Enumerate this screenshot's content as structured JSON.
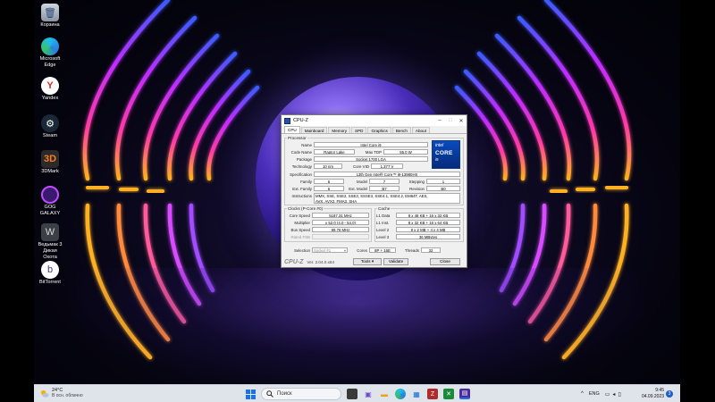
{
  "desktop": {
    "icons": [
      {
        "label": "Корзина",
        "icon": "recycle-bin-icon"
      },
      {
        "label": "Microsoft Edge",
        "icon": "edge-icon"
      },
      {
        "label": "Yandex",
        "icon": "yandex-icon"
      },
      {
        "label": "Steam",
        "icon": "steam-icon"
      },
      {
        "label": "3DMark",
        "icon": "3dmark-icon"
      },
      {
        "label": "GOG GALAXY",
        "icon": "gog-galaxy-icon"
      },
      {
        "label": "Ведьмак 3 Дикая Охота",
        "icon": "witcher-icon"
      },
      {
        "label": "BitTorrent",
        "icon": "bittorrent-icon"
      }
    ]
  },
  "cpuz": {
    "title": "CPU-Z",
    "tabs": [
      "CPU",
      "Mainboard",
      "Memory",
      "SPD",
      "Graphics",
      "Bench",
      "About"
    ],
    "active_tab": "CPU",
    "processor": {
      "legend": "Processor",
      "name_label": "Name",
      "name": "Intel Core i9",
      "codename_label": "Code Name",
      "codename": "Raptor Lake",
      "maxtdp_label": "Max TDP",
      "maxtdp": "55.0 W",
      "package_label": "Package",
      "package": "Socket 1700 LGA",
      "technology_label": "Technology",
      "technology": "10 nm",
      "corevid_label": "Core VID",
      "corevid": "1.377 V",
      "spec_label": "Specification",
      "spec": "13th Gen Intel® Core™ i9-13980HX",
      "family_label": "Family",
      "family": "6",
      "model_label": "Model",
      "model": "7",
      "stepping_label": "Stepping",
      "stepping": "1",
      "extfamily_label": "Ext. Family",
      "extfamily": "6",
      "extmodel_label": "Ext. Model",
      "extmodel": "B7",
      "revision_label": "Revision",
      "revision": "B0",
      "instr_label": "Instructions",
      "instr_line1": "MMX, SSE, SSE2, SSE3, SSSE3, SSE4.1, SSE4.2, EM64T, AES,",
      "instr_line2": "AVX, AVX2, FMA3, SHA"
    },
    "badge": {
      "brand": "intel",
      "line": "CORE",
      "tier": "i9"
    },
    "clocks": {
      "legend": "Clocks (P-Core #0)",
      "corespeed_label": "Core Speed",
      "corespeed": "5187.31 MHz",
      "multiplier_label": "Multiplier",
      "multiplier": "x 52.0 (4.0 - 54.0)",
      "busspeed_label": "Bus Speed",
      "busspeed": "99.76 MHz",
      "ratedfsb_label": "Rated FSB",
      "ratedfsb": ""
    },
    "cache": {
      "legend": "Cache",
      "l1data_label": "L1 Data",
      "l1data": "8 x 48 KB + 16 x 32 KB",
      "l1inst_label": "L1 Inst.",
      "l1inst": "8 x 32 KB + 16 x 64 KB",
      "level2_label": "Level 2",
      "level2": "8 x 2 MB + 4 x 4 MB",
      "level3_label": "Level 3",
      "level3": "36 MBytes"
    },
    "selection": {
      "selection_label": "Selection",
      "selection": "Socket #1",
      "cores_label": "Cores",
      "cores": "8P + 16E",
      "threads_label": "Threads",
      "threads": "32"
    },
    "footer": {
      "logo": "CPU-Z",
      "version": "Ver. 2.04.0.x64",
      "tools": "Tools",
      "validate": "Validate",
      "close": "Close"
    }
  },
  "taskbar": {
    "weather_temp": "24°C",
    "weather_desc": "В осн. облачно",
    "search_placeholder": "Поиск",
    "lang": "ENG",
    "time": "9:45",
    "date": "04.09.2023",
    "notification_count": "3"
  }
}
